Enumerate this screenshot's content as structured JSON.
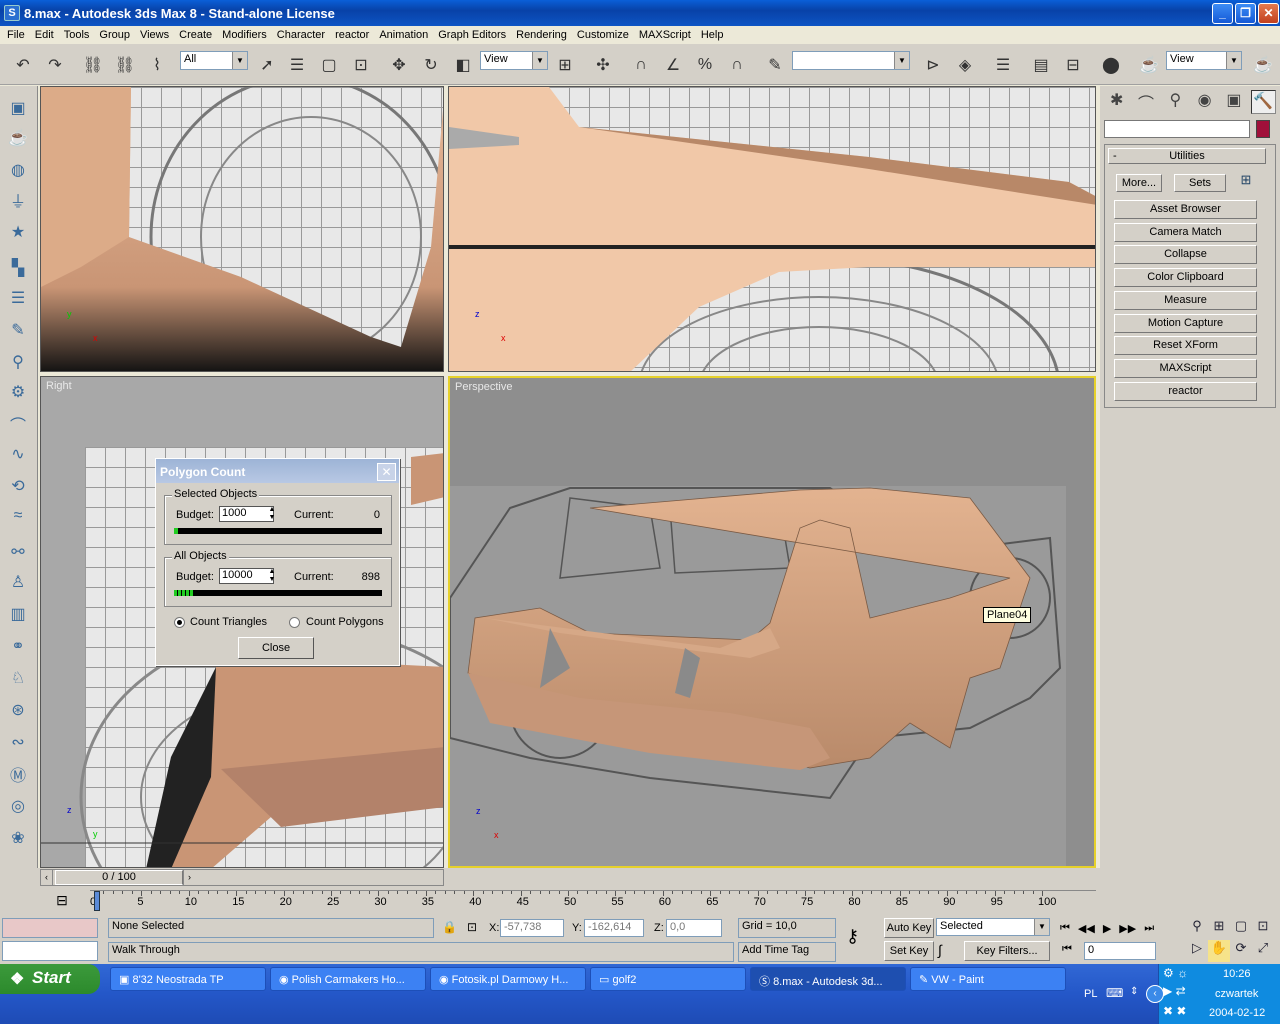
{
  "window": {
    "title": "8.max - Autodesk 3ds Max 8  - Stand-alone License",
    "icon": "S"
  },
  "menu": [
    "File",
    "Edit",
    "Tools",
    "Group",
    "Views",
    "Create",
    "Modifiers",
    "Character",
    "reactor",
    "Animation",
    "Graph Editors",
    "Rendering",
    "Customize",
    "MAXScript",
    "Help"
  ],
  "toolbar": {
    "selection_filter": "All",
    "ref_coord": "View",
    "named_selection": "",
    "view_right": "View"
  },
  "viewports": {
    "top_left": "",
    "top_right": "",
    "bottom_left": "Right",
    "bottom_right": "Perspective"
  },
  "axes": {
    "x": "x",
    "y": "y",
    "z": "z"
  },
  "object_label": "Plane04",
  "utilities": {
    "title": "Utilities",
    "collapse_symbol": "-",
    "more": "More...",
    "sets": "Sets",
    "buttons": [
      "Asset Browser",
      "Camera Match",
      "Collapse",
      "Color Clipboard",
      "Measure",
      "Motion Capture",
      "Reset XForm",
      "MAXScript",
      "reactor"
    ]
  },
  "dialog": {
    "title": "Polygon Count",
    "selected_group": "Selected Objects",
    "all_group": "All Objects",
    "budget_label": "Budget:",
    "current_label": "Current:",
    "selected_budget": "1000",
    "selected_current": "0",
    "all_budget": "10000",
    "all_current": "898",
    "count_triangles": "Count Triangles",
    "count_polygons": "Count Polygons",
    "close": "Close"
  },
  "timeline": {
    "slider": "0 / 100",
    "ticks": [
      "0",
      "5",
      "10",
      "15",
      "20",
      "25",
      "30",
      "35",
      "40",
      "45",
      "50",
      "55",
      "60",
      "65",
      "70",
      "75",
      "80",
      "85",
      "90",
      "95",
      "100"
    ]
  },
  "status": {
    "selection": "None Selected",
    "prompt": "Walk Through",
    "x_label": "X:",
    "x": "-57,738",
    "y_label": "Y:",
    "y": "-162,614",
    "z_label": "Z:",
    "z": "0,0",
    "grid": "Grid = 10,0",
    "add_time_tag": "Add Time Tag",
    "auto_key": "Auto Key",
    "set_key": "Set Key",
    "key_mode": "Selected",
    "key_filters": "Key Filters...",
    "frame": "0"
  },
  "taskbar": {
    "start": "Start",
    "tasks": [
      "8'32 Neostrada TP",
      "Polish Carmakers Ho...",
      "Fotosik.pl Darmowy H...",
      "golf2",
      "8.max - Autodesk 3d...",
      "VW - Paint"
    ],
    "lang": "PL",
    "time": "10:26",
    "day": "czwartek",
    "date": "2004-02-12"
  }
}
